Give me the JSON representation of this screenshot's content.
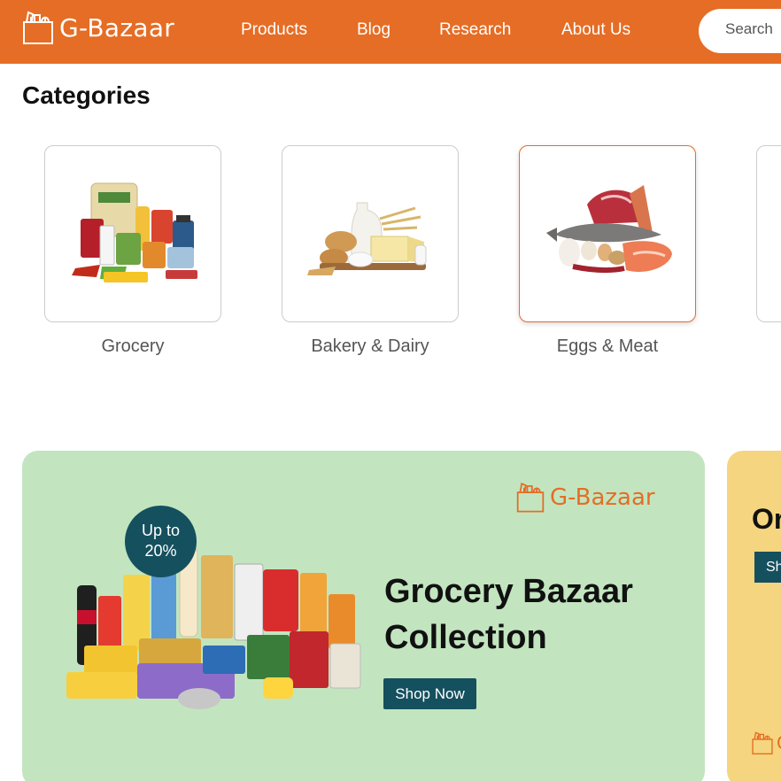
{
  "header": {
    "brand": "G-Bazaar",
    "nav": [
      {
        "label": "Products"
      },
      {
        "label": "Blog"
      },
      {
        "label": "Research"
      },
      {
        "label": "About Us"
      }
    ],
    "search_placeholder": "Search",
    "colors": {
      "background": "#e56d25",
      "text": "#ffffff"
    }
  },
  "categories": {
    "title": "Categories",
    "items": [
      {
        "label": "Grocery",
        "icon": "grocery-image"
      },
      {
        "label": "Bakery & Dairy",
        "icon": "bakery-dairy-image"
      },
      {
        "label": "Eggs & Meat",
        "icon": "eggs-meat-image",
        "selected": true
      }
    ],
    "accent": "#e56d25"
  },
  "banner": {
    "brand": "G-Bazaar",
    "badge_line1": "Up to",
    "badge_line2": "20%",
    "title_line1": "Grocery Bazaar",
    "title_line2": "Collection",
    "cta": "Shop Now",
    "colors": {
      "background": "#c2e5bf",
      "button": "#15505e",
      "badge": "#15505e"
    }
  },
  "banner2": {
    "title": "Or",
    "cta": "Sh",
    "brand": "G",
    "colors": {
      "background": "#f5d57f"
    }
  }
}
